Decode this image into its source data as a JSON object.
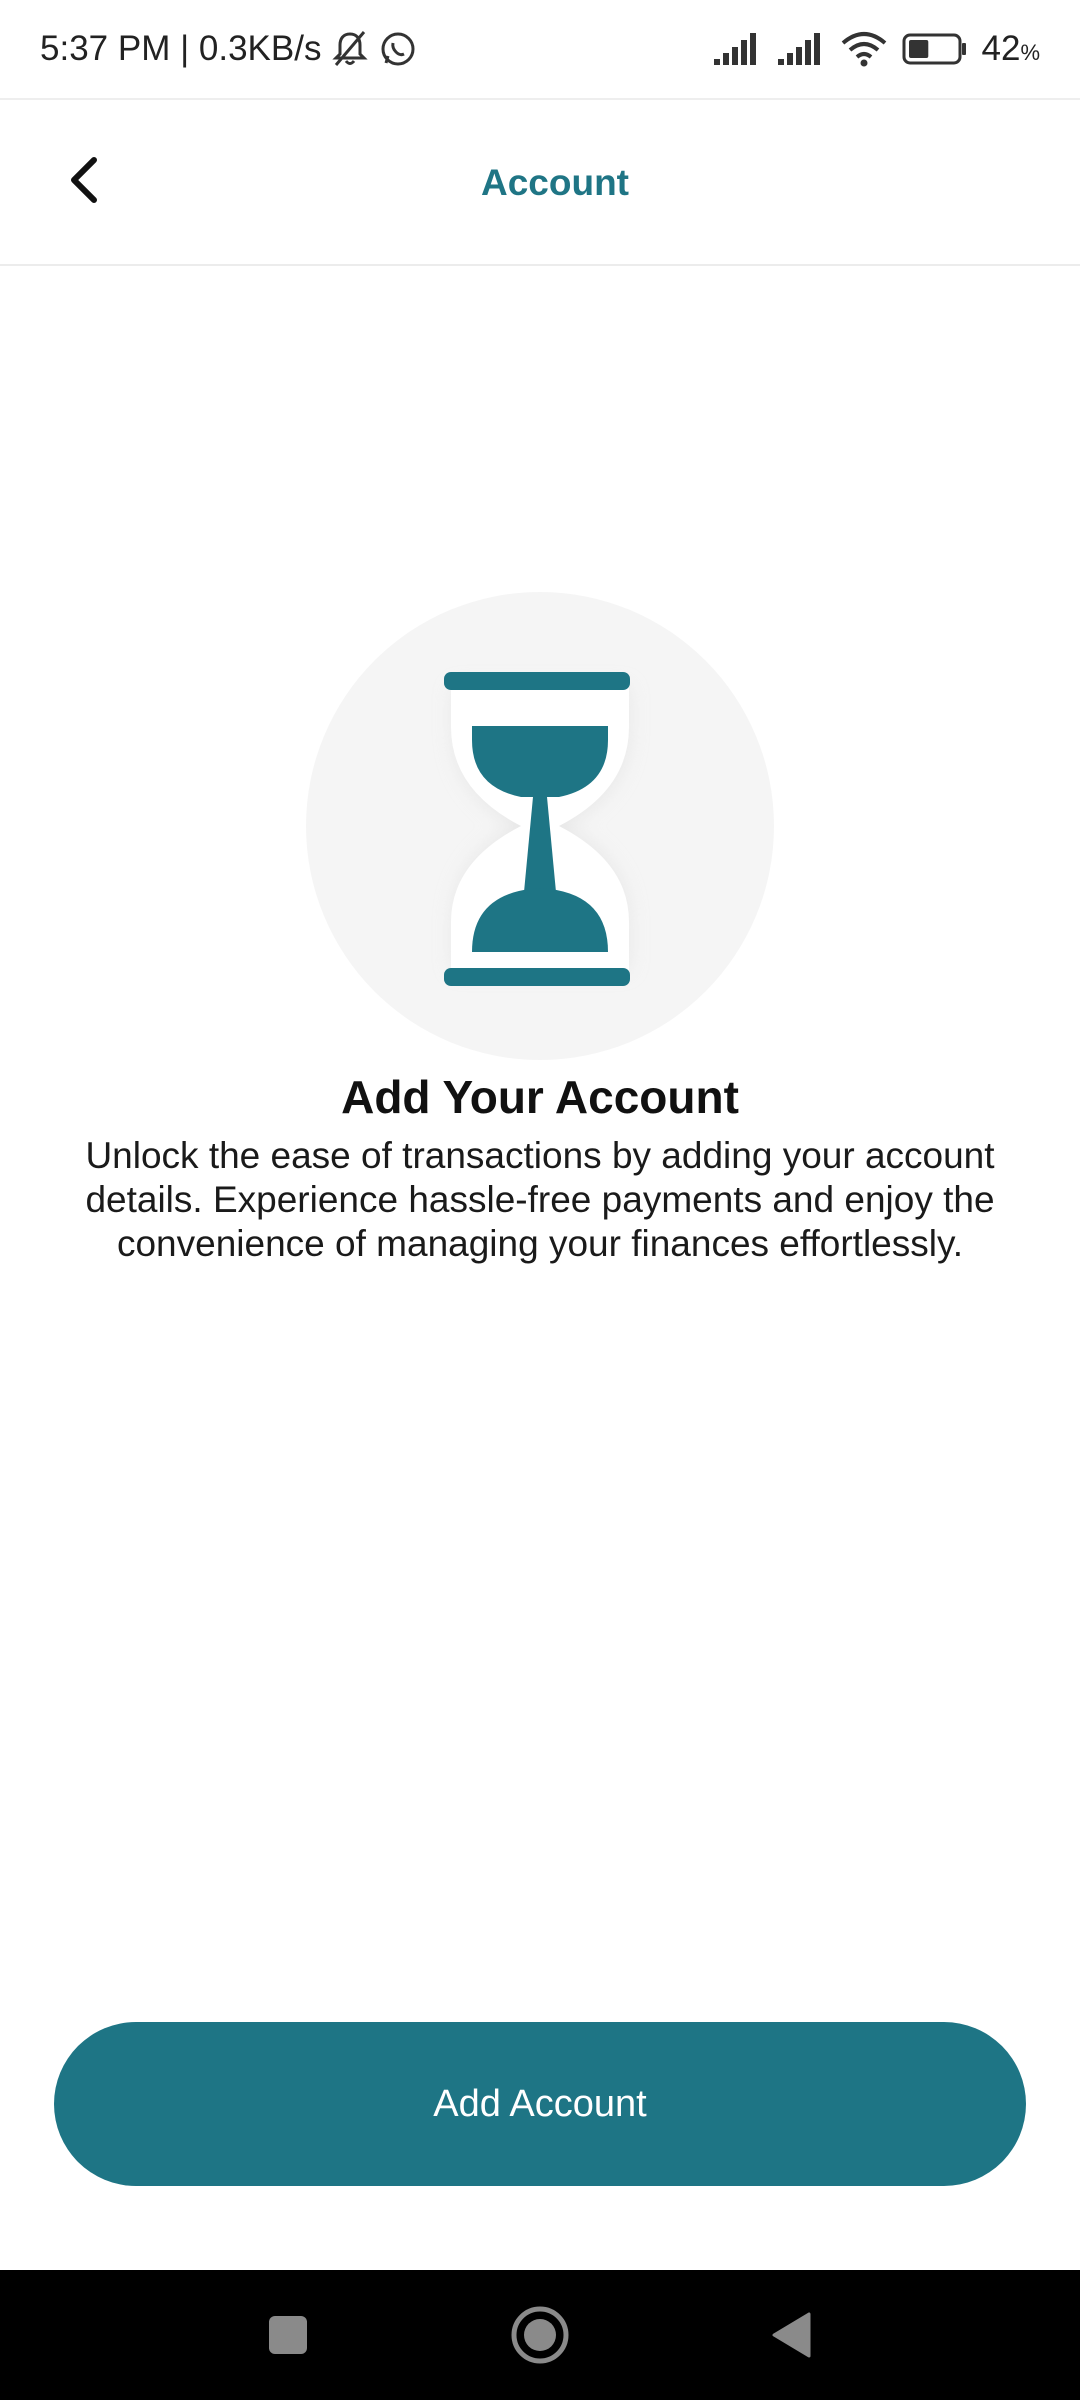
{
  "status_bar": {
    "time_speed": "5:37 PM | 0.3KB/s",
    "battery_percent": "42",
    "battery_unit": "%",
    "battery_level": 0.42,
    "icons": [
      "bell-off-icon",
      "whatsapp-icon",
      "signal-icon",
      "signal-icon",
      "wifi-icon",
      "battery-icon"
    ]
  },
  "app_bar": {
    "title": "Account",
    "back_icon": "chevron-left-icon"
  },
  "empty_state": {
    "illustration_icon": "hourglass-icon",
    "title": "Add Your Account",
    "description": "Unlock the ease of transactions by adding your account details. Experience hassle-free payments and enjoy the convenience of managing your finances effortlessly."
  },
  "actions": {
    "add_account_label": "Add Account"
  },
  "nav_bar": {
    "icons": [
      "recents-square-icon",
      "home-circle-icon",
      "back-triangle-icon"
    ]
  },
  "colors": {
    "accent": "#1E7585",
    "title_text": "#1F7585",
    "illustration_bg": "#F5F5F5",
    "nav_bg": "#000000"
  }
}
